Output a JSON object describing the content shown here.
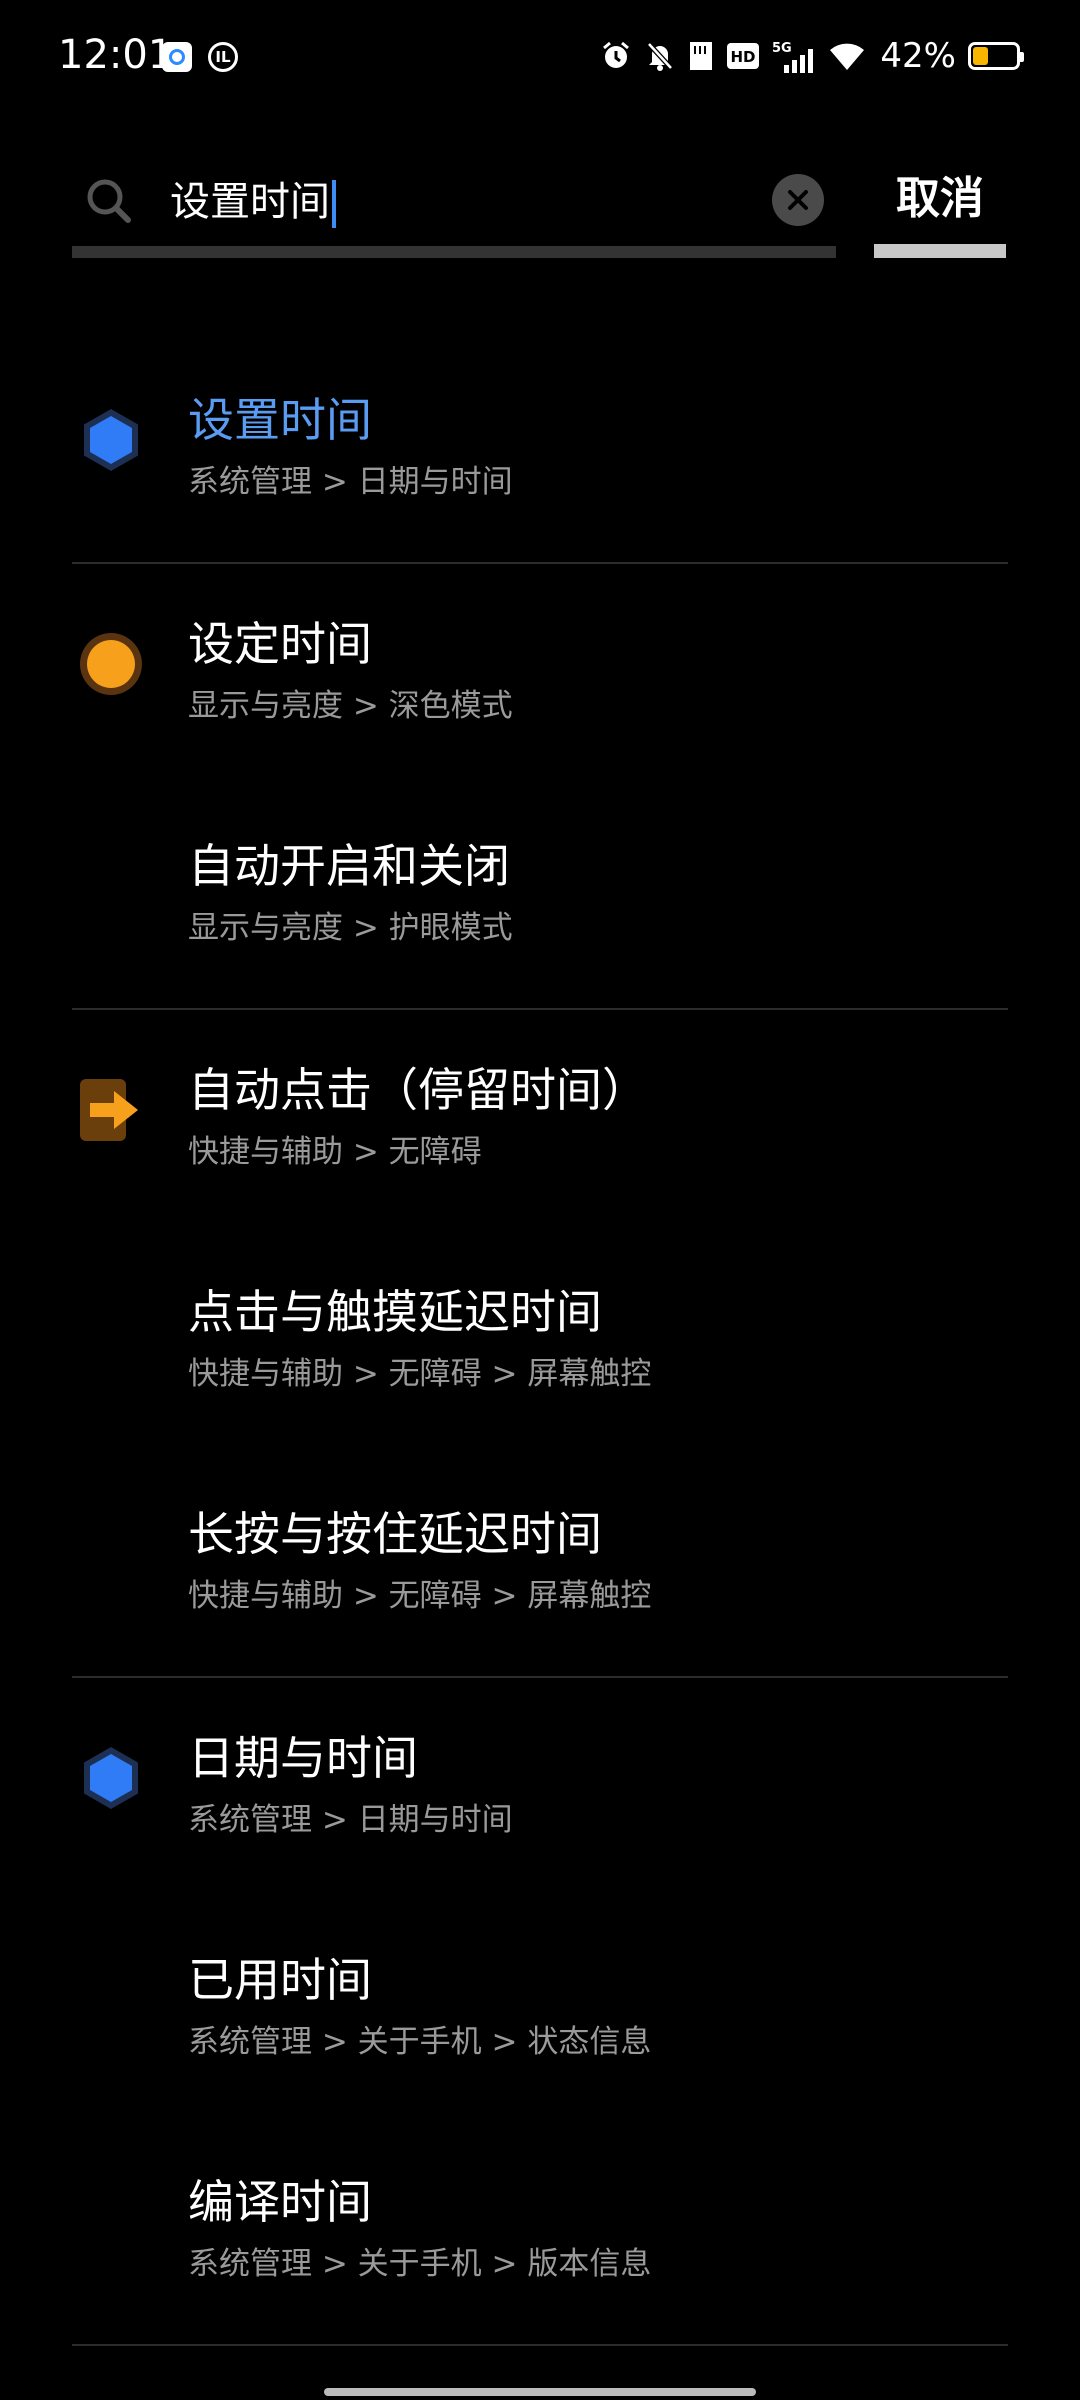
{
  "status_bar": {
    "time": "12:01",
    "app_icon_2_label": "IL",
    "network_label": "5G",
    "battery_percent": "42%",
    "battery_level": 0.42,
    "battery_color": "#f7b500"
  },
  "search": {
    "query": "设置时间",
    "cancel_label": "取消"
  },
  "groups": [
    [
      {
        "title": "设置时间",
        "path": "系统管理 > 日期与时间",
        "icon": "blue-hexagon-icon",
        "highlighted": true
      }
    ],
    [
      {
        "title": "设定时间",
        "path": "显示与亮度 > 深色模式",
        "icon": "orange-circle-icon"
      },
      {
        "title": "自动开启和关闭",
        "path": "显示与亮度 > 护眼模式",
        "icon": ""
      }
    ],
    [
      {
        "title": "自动点击（停留时间）",
        "path": "快捷与辅助 > 无障碍",
        "icon": "orange-arrow-icon"
      },
      {
        "title": "点击与触摸延迟时间",
        "path": "快捷与辅助 > 无障碍 > 屏幕触控",
        "icon": ""
      },
      {
        "title": "长按与按住延迟时间",
        "path": "快捷与辅助 > 无障碍 > 屏幕触控",
        "icon": ""
      }
    ],
    [
      {
        "title": "日期与时间",
        "path": "系统管理 > 日期与时间",
        "icon": "blue-hexagon-icon"
      },
      {
        "title": "已用时间",
        "path": "系统管理 > 关于手机 > 状态信息",
        "icon": ""
      },
      {
        "title": "编译时间",
        "path": "系统管理 > 关于手机 > 版本信息",
        "icon": ""
      }
    ]
  ],
  "colors": {
    "accent": "#5b9cf3",
    "hexagon": "#2f7cf6",
    "orange": "#f7a01c"
  }
}
